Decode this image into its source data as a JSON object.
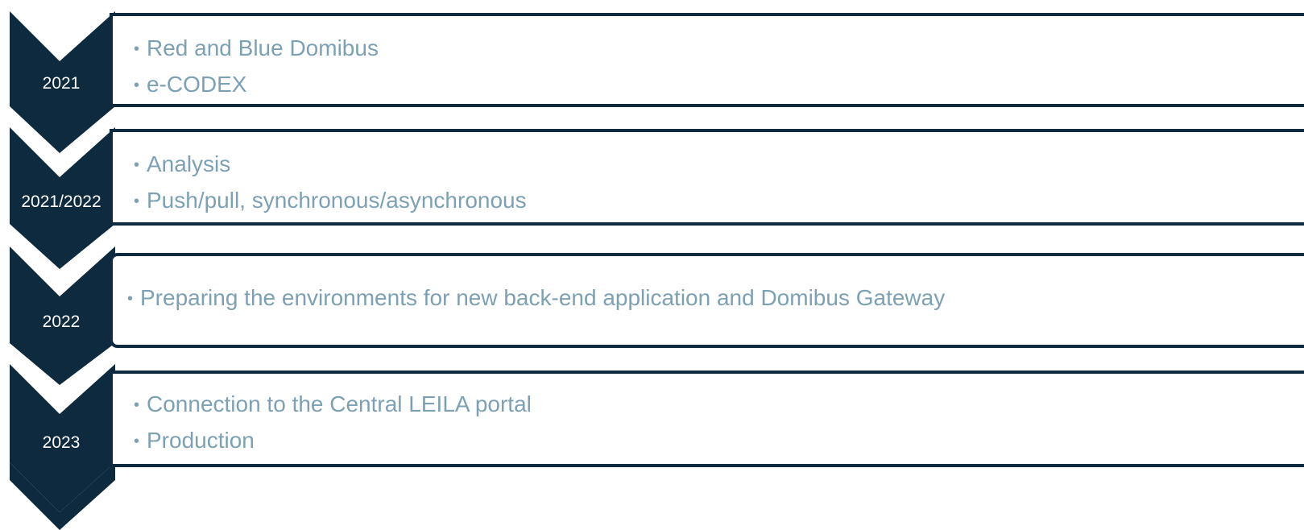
{
  "timeline": {
    "steps": [
      {
        "year": "2021",
        "items": [
          "Red and Blue Domibus",
          "e-CODEX"
        ]
      },
      {
        "year": "2021/2022",
        "items": [
          "Analysis",
          "Push/pull, synchronous/asynchronous"
        ]
      },
      {
        "year": "2022",
        "items": [
          "Preparing the environments for new back-end application and Domibus Gateway"
        ]
      },
      {
        "year": "2023",
        "items": [
          "Connection to the Central LEILA portal",
          "Production"
        ]
      }
    ]
  },
  "colors": {
    "chevron": "#0d2a3f",
    "border": "#0d2a3f",
    "item_text": "#7da1b4",
    "year_text": "#ffffff"
  },
  "icons": {
    "bullet": "•"
  }
}
